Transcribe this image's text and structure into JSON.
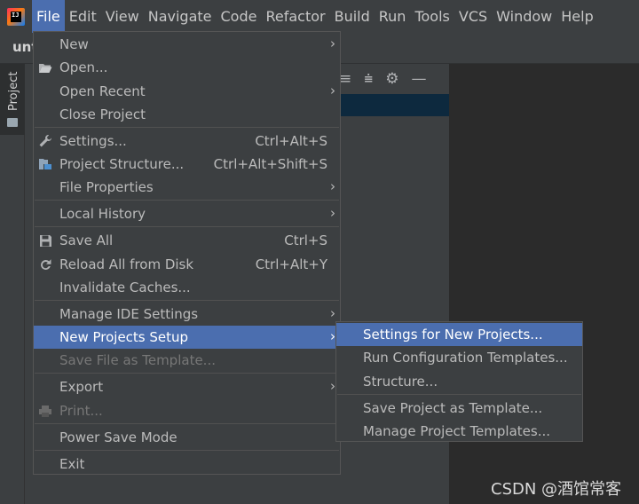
{
  "menubar": {
    "items": [
      "File",
      "Edit",
      "View",
      "Navigate",
      "Code",
      "Refactor",
      "Build",
      "Run",
      "Tools",
      "VCS",
      "Window",
      "Help"
    ],
    "active": "File"
  },
  "project": {
    "name": "unt",
    "tool_tab": "Project"
  },
  "file_menu": {
    "items": [
      {
        "label": "New",
        "submenu": true
      },
      {
        "label": "Open...",
        "icon": "folder-open-icon"
      },
      {
        "label": "Open Recent",
        "submenu": true
      },
      {
        "label": "Close Project"
      },
      {
        "label": "Settings...",
        "shortcut": "Ctrl+Alt+S",
        "icon": "wrench-icon"
      },
      {
        "label": "Project Structure...",
        "shortcut": "Ctrl+Alt+Shift+S",
        "icon": "project-structure-icon"
      },
      {
        "label": "File Properties",
        "submenu": true
      },
      {
        "label": "Local History",
        "submenu": true
      },
      {
        "label": "Save All",
        "shortcut": "Ctrl+S",
        "icon": "save-icon"
      },
      {
        "label": "Reload All from Disk",
        "shortcut": "Ctrl+Alt+Y",
        "icon": "reload-icon"
      },
      {
        "label": "Invalidate Caches..."
      },
      {
        "label": "Manage IDE Settings",
        "submenu": true
      },
      {
        "label": "New Projects Setup",
        "submenu": true,
        "highlighted": true
      },
      {
        "label": "Save File as Template...",
        "disabled": true
      },
      {
        "label": "Export",
        "submenu": true
      },
      {
        "label": "Print...",
        "disabled": true,
        "icon": "printer-icon"
      },
      {
        "label": "Power Save Mode"
      },
      {
        "label": "Exit"
      }
    ]
  },
  "sub_menu": {
    "items": [
      {
        "label": "Settings for New Projects...",
        "highlighted": true
      },
      {
        "label": "Run Configuration Templates..."
      },
      {
        "label": "Structure..."
      },
      {
        "label": "Save Project as Template..."
      },
      {
        "label": "Manage Project Templates..."
      }
    ]
  },
  "watermark": "CSDN @酒馆常客",
  "colors": {
    "menu_background": "#3c3f41",
    "highlight": "#4b6eaf",
    "editor_background": "#2b2b2b",
    "text": "#bbbbbb",
    "disabled_text": "#777777"
  }
}
